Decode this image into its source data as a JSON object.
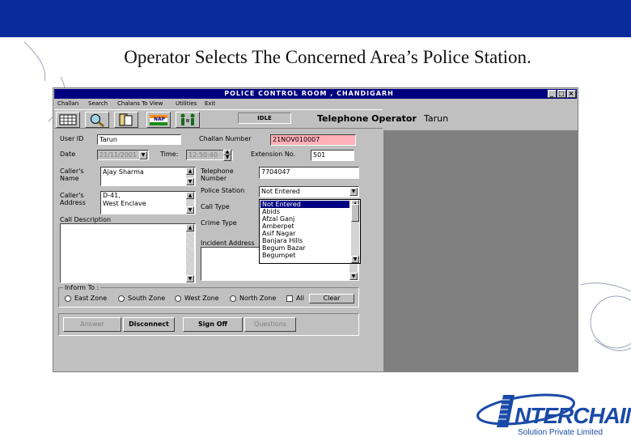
{
  "slide": {
    "title": "Operator Selects The Concerned Area’s Police Station.",
    "accent_color": "#0a2c9a"
  },
  "window": {
    "title": "POLICE CONTROL ROOM , CHANDIGARH",
    "controls": [
      "_",
      "□",
      "×"
    ],
    "menu": [
      "Challan",
      "Search",
      "Chalans To View",
      "Utilities",
      "Exit"
    ],
    "toolbar_icons": [
      "grid-icon",
      "magnifier-icon",
      "clipboard-icon",
      "flag-icon",
      "people-icon"
    ],
    "toolbar_flag_text": "NAP",
    "status": "IDLE",
    "operator_role": "Telephone Operator",
    "operator_name": "Tarun"
  },
  "form": {
    "user_id_label": "User ID",
    "user_id": "Tarun",
    "challan_number_label": "Challan Number",
    "challan_number": "21NOV010007",
    "date_label": "Date",
    "date": "21/11/2001",
    "time_label": "Time:",
    "time": "12:50:40",
    "extension_label": "Extension No.",
    "extension": "501",
    "callers_name_label": "Caller's Name",
    "callers_name": "Ajay Sharma",
    "telephone_label": "Telephone Number",
    "telephone": "7704047",
    "callers_address_label": "Caller's Address",
    "callers_address": "D-41,\nWest Enclave",
    "police_station_label": "Police Station",
    "police_station": "Not Entered",
    "call_type_label": "Call Type",
    "crime_type_label": "Crime Type",
    "call_description_label": "Call Description",
    "incident_address_label": "Incident Address",
    "police_station_options": [
      "Not Entered",
      "Abids",
      "Afzal Ganj",
      "Amberpet",
      "Asif Nagar",
      "Banjara Hills",
      "Begum Bazar",
      "Begumpet"
    ],
    "selected_option": "Not Entered"
  },
  "inform_to": {
    "legend": "Inform To :",
    "options": [
      "East Zone",
      "South Zone",
      "West Zone",
      "North Zone",
      "All"
    ],
    "clear_label": "Clear"
  },
  "actions": {
    "answer": "Answer",
    "disconnect": "Disconnect",
    "sign_off": "Sign Off",
    "questions": "Questions"
  },
  "logo": {
    "name": "NTERCHAIN",
    "tagline": "Solution Private Limited",
    "color": "#1a4aa8"
  }
}
